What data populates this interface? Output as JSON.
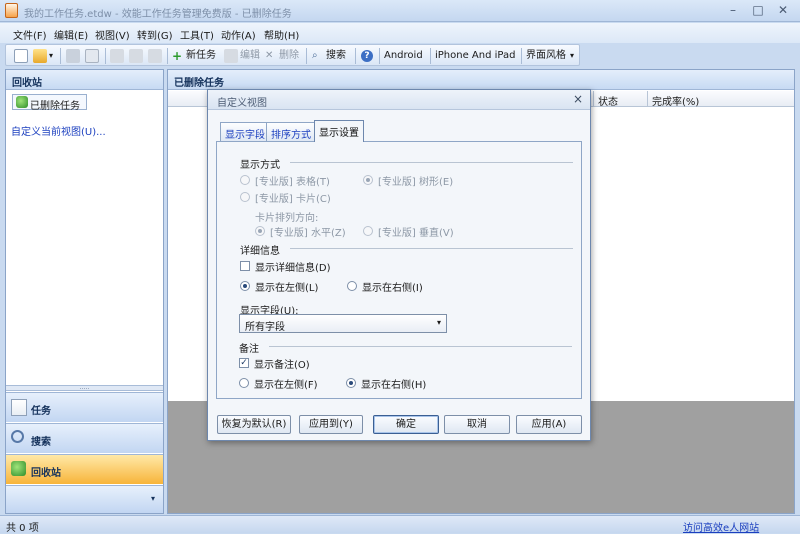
{
  "window": {
    "title": "我的工作任务.etdw - 效能工作任务管理免费版 - 已删除任务",
    "minimize": "–",
    "maximize": "□",
    "close": "✕"
  },
  "menu": [
    "文件(F)",
    "编辑(E)",
    "视图(V)",
    "转到(G)",
    "工具(T)",
    "动作(A)",
    "帮助(H)"
  ],
  "toolbar": {
    "new_task": "新任务",
    "edit": "编辑",
    "delete": "删除",
    "search": "搜索",
    "android": "Android",
    "iphone": "iPhone And iPad",
    "theme": "界面风格",
    "theme_arrow": "▾",
    "help": "?",
    "new_arrow": "▾"
  },
  "left_panel": {
    "header": "回收站",
    "tree_item": "已删除任务",
    "custom_view_link": "自定义当前视图(U)...",
    "splitter_dots": ".....",
    "nav": [
      {
        "label": "任务"
      },
      {
        "label": "搜索"
      },
      {
        "label": "回收站"
      }
    ],
    "more_arrow": "▾"
  },
  "right_panel": {
    "header": "已删除任务",
    "columns": [
      "状态",
      "完成率(%)"
    ]
  },
  "dialog": {
    "title": "自定义视图",
    "close": "×",
    "tabs": [
      "显示字段",
      "排序方式",
      "显示设置"
    ],
    "display_mode": {
      "label": "显示方式",
      "table": "[专业版] 表格(T)",
      "tree": "[专业版] 树形(E)",
      "card": "[专业版] 卡片(C)",
      "card_direction": "卡片排列方向:",
      "horizontal": "[专业版] 水平(Z)",
      "vertical": "[专业版] 垂直(V)"
    },
    "detail": {
      "label": "详细信息",
      "show_detail": "显示详细信息(D)",
      "left": "显示在左侧(L)",
      "right": "显示在右侧(I)",
      "field_label": "显示字段(U):",
      "field_value": "所有字段",
      "field_arrow": "▾"
    },
    "notes": {
      "label": "备注",
      "show_notes": "显示备注(O)",
      "left": "显示在左侧(F)",
      "right": "显示在右侧(H)",
      "check_mark": "✓"
    },
    "buttons": {
      "restore": "恢复为默认(R)",
      "apply_to": "应用到(Y)",
      "ok": "确定",
      "cancel": "取消",
      "apply": "应用(A)"
    }
  },
  "status": {
    "count": "共 0 项",
    "link": "访问高效e人网站"
  }
}
